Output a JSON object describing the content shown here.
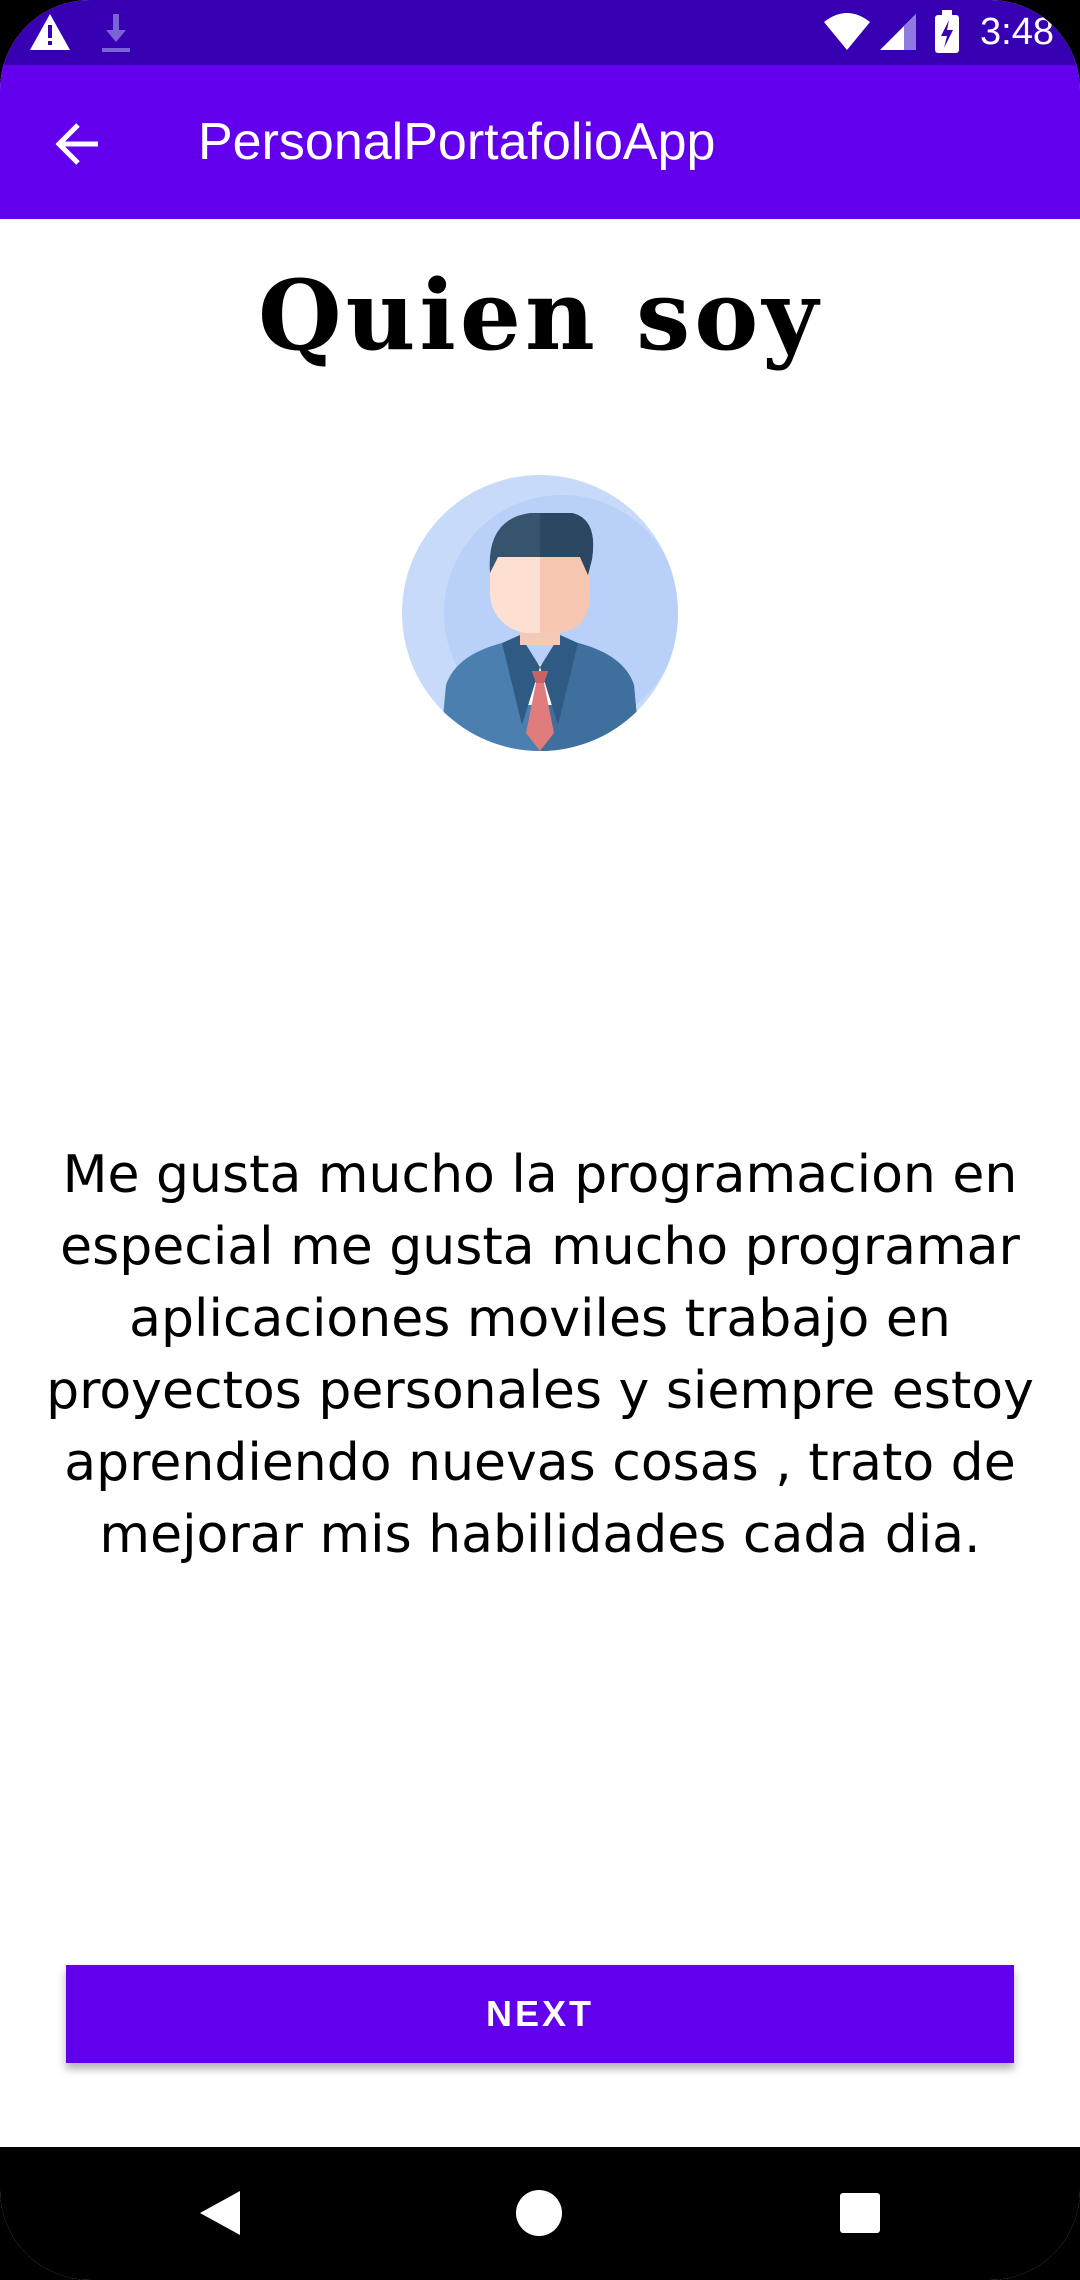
{
  "status_bar": {
    "time": "3:48",
    "icons": [
      "warning-icon",
      "download-icon",
      "wifi-icon",
      "signal-icon",
      "battery-icon"
    ]
  },
  "app_bar": {
    "title": "PersonalPortafolioApp",
    "back_icon": "arrow-back-icon"
  },
  "main": {
    "heading": "Quien soy",
    "avatar_icon": "businessman-avatar",
    "bio_lines": [
      "Me gusta mucho la programacion en",
      "especial me gusta mucho programar",
      "aplicaciones moviles trabajo en",
      "proyectos personales y siempre estoy",
      "aprendiendo nuevas cosas , trato de",
      "mejorar mis habilidades cada dia."
    ],
    "next_label": "NEXT"
  },
  "nav_bar": {
    "icons": [
      "back-triangle-icon",
      "home-circle-icon",
      "recents-square-icon"
    ]
  },
  "colors": {
    "status_bar": "#3700b3",
    "primary": "#6200ee",
    "background": "#ffffff"
  }
}
